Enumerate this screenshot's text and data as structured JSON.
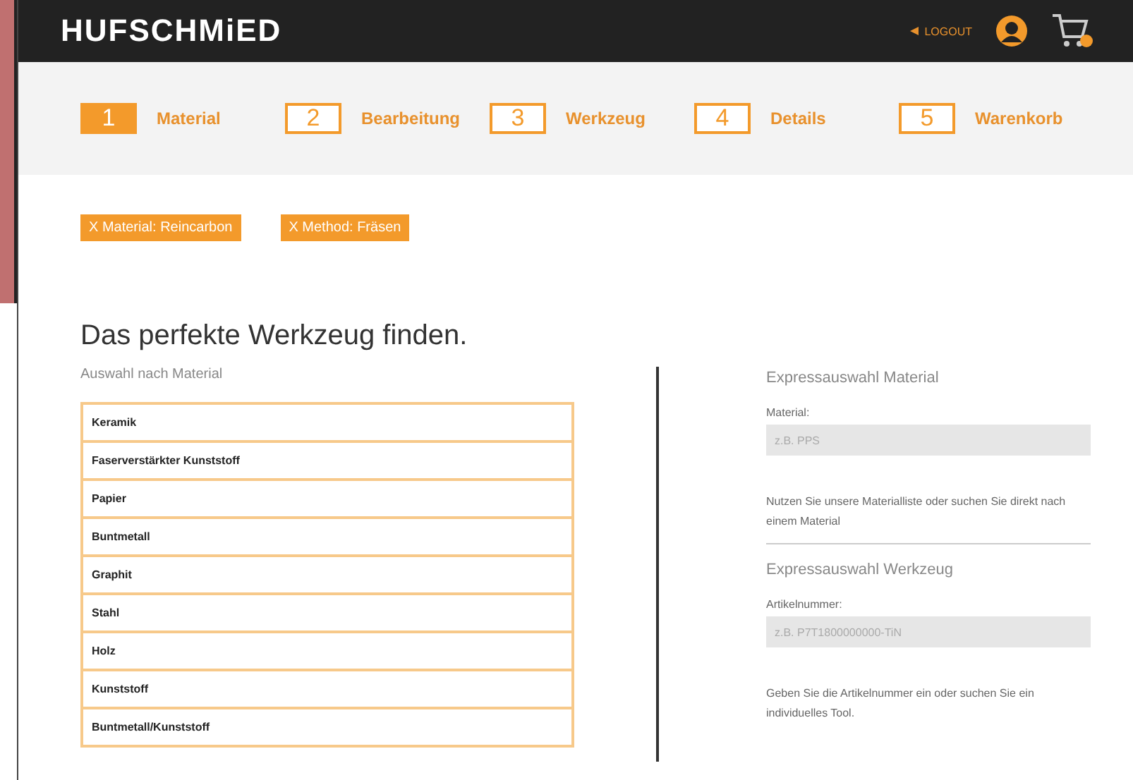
{
  "header": {
    "logo": "HUFSCHMiED",
    "logout": "LOGOUT"
  },
  "steps": [
    {
      "number": "1",
      "label": "Material",
      "selected": true
    },
    {
      "number": "2",
      "label": "Bearbeitung",
      "selected": false
    },
    {
      "number": "3",
      "label": "Werkzeug",
      "selected": false
    },
    {
      "number": "4",
      "label": "Details",
      "selected": false
    },
    {
      "number": "5",
      "label": "Warenkorb",
      "selected": false
    }
  ],
  "filters": [
    "X  Material: Reincarbon",
    "X  Method: Fräsen"
  ],
  "heading": "Das perfekte Werkzeug finden.",
  "material_list": {
    "title": "Auswahl nach Material",
    "items": [
      "Keramik",
      "Faserverstärkter Kunststoff",
      "Papier",
      "Buntmetall",
      "Graphit",
      "Stahl",
      "Holz",
      "Kunststoff",
      "Buntmetall/Kunststoff"
    ]
  },
  "express_material": {
    "title": "Expressauswahl Material",
    "label": "Material:",
    "placeholder": "z.B. PPS",
    "hint": "Nutzen Sie unsere Materialliste oder suchen Sie direkt nach einem Material"
  },
  "express_tool": {
    "title": "Expressauswahl Werkzeug",
    "label": "Artikelnummer:",
    "placeholder": "z.B. P7T1800000000-TiN",
    "hint": "Geben Sie die Artikelnummer ein oder suchen Sie ein individuelles Tool."
  }
}
